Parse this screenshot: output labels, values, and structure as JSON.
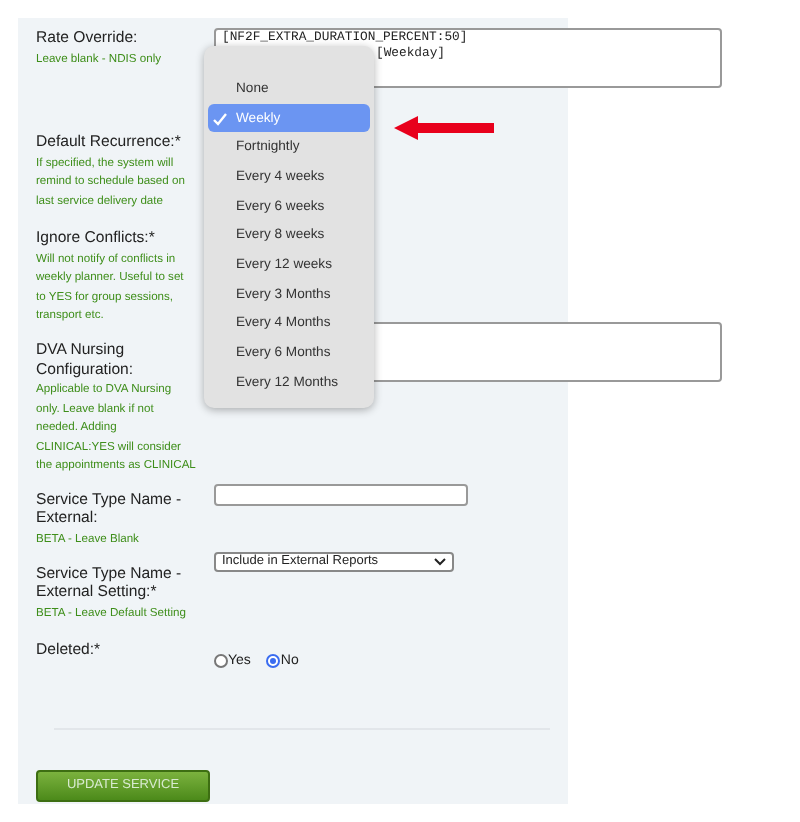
{
  "fields": [
    {
      "kind": "textarea",
      "label": "Rate Override:",
      "hint": "Leave blank - NDIS only",
      "lines": [
        "[NF2F_EXTRA_DURATION_PERCENT:50]",
        "[Weekday]"
      ]
    },
    {
      "kind": "select-hidden",
      "label": "Default Recurrence:*",
      "hint": "If specified, the system will remind to schedule based on last service delivery date"
    },
    {
      "kind": "none",
      "label": "Ignore Conflicts:*",
      "hint": "Will not notify of conflicts in weekly planner. Useful to set to YES for group sessions, transport etc."
    },
    {
      "kind": "textarea",
      "label": "DVA Nursing Configuration:",
      "hint": "Applicable to DVA Nursing only. Leave blank if not needed. Adding CLINICAL:YES will consider the appointments as CLINICAL"
    },
    {
      "kind": "input",
      "label": "Service Type Name - External:",
      "hint": "BETA - Leave Blank"
    },
    {
      "kind": "select",
      "label": "Service Type Name - External Setting:*",
      "hint": "BETA - Leave Default Setting",
      "value": "Include in External Reports"
    },
    {
      "kind": "radio",
      "label": "Deleted:*",
      "options": [
        {
          "label": "Yes",
          "selected": false
        },
        {
          "label": "No",
          "selected": true
        }
      ]
    }
  ],
  "menu": [
    {
      "label": "None",
      "selected": false
    },
    {
      "label": "Weekly",
      "selected": true
    },
    {
      "label": "Fortnightly",
      "selected": false
    },
    {
      "label": "Every 4 weeks",
      "selected": false
    },
    {
      "label": "Every 6 weeks",
      "selected": false
    },
    {
      "label": "Every 8 weeks",
      "selected": false
    },
    {
      "label": "Every 12 weeks",
      "selected": false
    },
    {
      "label": "Every 3 Months",
      "selected": false
    },
    {
      "label": "Every 4 Months",
      "selected": false
    },
    {
      "label": "Every 6 Months",
      "selected": false
    },
    {
      "label": "Every 12 Months",
      "selected": false
    }
  ],
  "submit": "UPDATE SERVICE"
}
